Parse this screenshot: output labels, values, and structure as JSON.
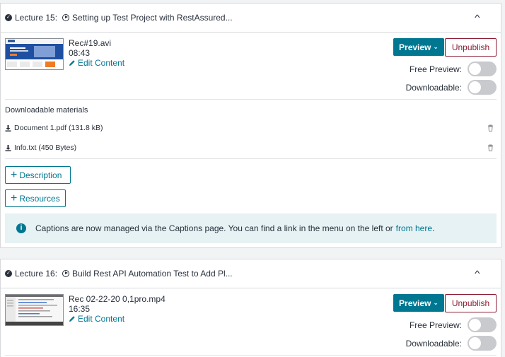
{
  "lectures": [
    {
      "number_label": "Lecture 15:",
      "title": "Setting up Test Project with RestAssured...",
      "file_name": "Rec#19.avi",
      "duration": "08:43",
      "edit_label": "Edit Content",
      "preview_label": "Preview",
      "unpublish_label": "Unpublish",
      "free_preview_label": "Free Preview:",
      "downloadable_label": "Downloadable:",
      "free_preview_on": false,
      "downloadable_on": false,
      "downloadable_materials_title": "Downloadable materials",
      "materials": [
        "Document 1.pdf (131.8 kB)",
        "Info.txt (450 Bytes)"
      ],
      "description_label": "Description",
      "resources_label": "Resources",
      "info_text": "Captions are now managed via the Captions page. You can find a link in the menu on the left or",
      "info_link": "from here",
      "info_end": "."
    },
    {
      "number_label": "Lecture 16:",
      "title": "Build Rest API Automation Test to Add Pl...",
      "file_name": "Rec 02-22-20 0,1pro.mp4",
      "duration": "16:35",
      "edit_label": "Edit Content",
      "preview_label": "Preview",
      "unpublish_label": "Unpublish",
      "free_preview_label": "Free Preview:",
      "downloadable_label": "Downloadable:",
      "free_preview_on": false,
      "downloadable_on": false
    }
  ],
  "colors": {
    "accent": "#007791",
    "unpublish": "#8b1c33",
    "info_bg": "#e6f2f4"
  }
}
